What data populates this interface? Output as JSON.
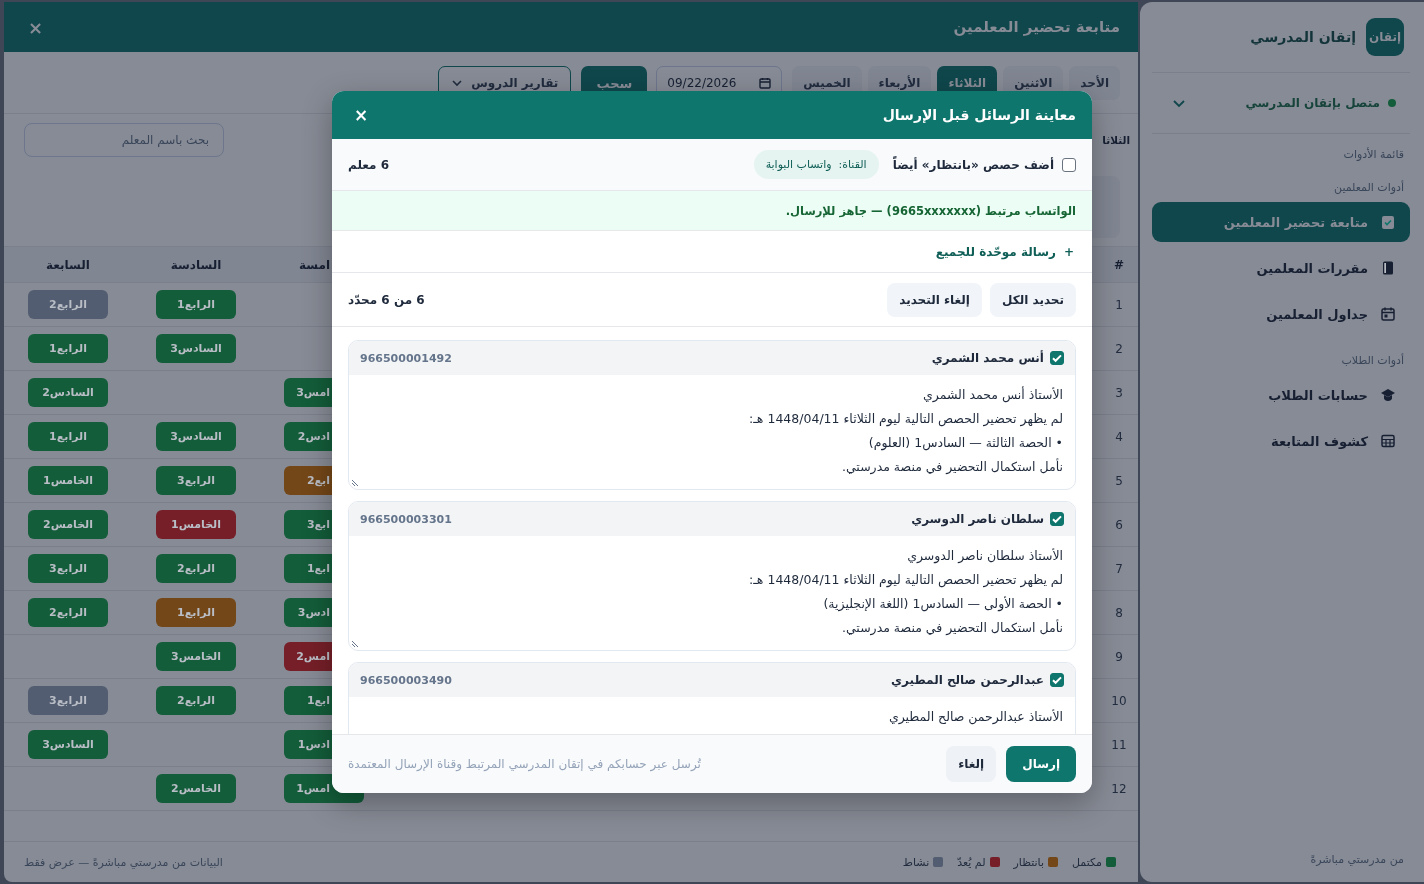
{
  "main_panel": {
    "title": "متابعة تحضير المعلمين",
    "close": "×"
  },
  "day_tabs": [
    {
      "label": "الأحد",
      "selected": false
    },
    {
      "label": "الاثنين",
      "selected": false
    },
    {
      "label": "الثلاثاء",
      "selected": true
    },
    {
      "label": "الأربعاء",
      "selected": false
    },
    {
      "label": "الخميس",
      "selected": false
    }
  ],
  "date_field": {
    "value": "09/22/2026"
  },
  "pull_button": "سحب",
  "reports_dropdown": {
    "label": "تقارير الدروس"
  },
  "day_heading": "الثلاثا",
  "search": {
    "placeholder": "بحث باسم المعلم"
  },
  "table": {
    "columns": [
      "#",
      "امسة",
      "السادسة",
      "السابعة"
    ],
    "rows": [
      {
        "cells": [
          "1",
          null,
          {
            "text": "الرابع1",
            "color": "#135d3a"
          },
          {
            "text": "الرابع2",
            "color": "#525d71"
          }
        ]
      },
      {
        "cells": [
          "2",
          null,
          {
            "text": "السادس3",
            "color": "#135d3a"
          },
          {
            "text": "الرابع1",
            "color": "#135d3a"
          }
        ]
      },
      {
        "cells": [
          "3",
          {
            "text": "امس3",
            "color": "#135d3a"
          },
          null,
          {
            "text": "السادس2",
            "color": "#135d3a"
          }
        ]
      },
      {
        "cells": [
          "4",
          {
            "text": "ادس2",
            "color": "#135d3a"
          },
          {
            "text": "السادس3",
            "color": "#135d3a"
          },
          {
            "text": "الرابع1",
            "color": "#135d3a"
          }
        ]
      },
      {
        "cells": [
          "5",
          {
            "text": "ابع2",
            "color": "#744718"
          },
          {
            "text": "الرابع3",
            "color": "#135d3a"
          },
          {
            "text": "الخامس1",
            "color": "#135d3a"
          }
        ]
      },
      {
        "cells": [
          "6",
          {
            "text": "ابع3",
            "color": "#135d3a"
          },
          {
            "text": "الخامس1",
            "color": "#761f28"
          },
          {
            "text": "الخامس2",
            "color": "#135d3a"
          }
        ]
      },
      {
        "cells": [
          "7",
          {
            "text": "ابع1",
            "color": "#135d3a"
          },
          {
            "text": "الرابع2",
            "color": "#135d3a"
          },
          {
            "text": "الرابع3",
            "color": "#135d3a"
          }
        ]
      },
      {
        "cells": [
          "8",
          {
            "text": "ادس3",
            "color": "#135d3a"
          },
          {
            "text": "الرابع1",
            "color": "#744718"
          },
          {
            "text": "الرابع2",
            "color": "#135d3a"
          }
        ]
      },
      {
        "cells": [
          "9",
          {
            "text": "امس2",
            "color": "#761f28"
          },
          {
            "text": "الخامس3",
            "color": "#135d3a"
          },
          null
        ]
      },
      {
        "cells": [
          "10",
          {
            "text": "ابع1",
            "color": "#135d3a"
          },
          {
            "text": "الرابع2",
            "color": "#135d3a"
          },
          {
            "text": "الرابع3",
            "color": "#525d71"
          }
        ]
      },
      {
        "cells": [
          "11",
          {
            "text": "ادس1",
            "color": "#135d3a"
          },
          null,
          {
            "text": "السادس3",
            "color": "#135d3a"
          }
        ]
      },
      {
        "cells": [
          "12",
          {
            "text": "امس1",
            "color": "#135d3a"
          },
          {
            "text": "الخامس2",
            "color": "#135d3a"
          },
          null
        ]
      }
    ]
  },
  "legend": [
    {
      "label": "مكتمل",
      "color": "#135d3a"
    },
    {
      "label": "بانتظار",
      "color": "#744718"
    },
    {
      "label": "لم يُعدّ",
      "color": "#761f28"
    },
    {
      "label": "نشاط",
      "color": "#525d71"
    }
  ],
  "footer_note": "البيانات من مدرستي مباشرةً — عرض فقط",
  "sidebar": {
    "logo_text": "إتقان",
    "brand": "إتقان المدرسي",
    "connection": {
      "label": "متصل بإتقان المدرسي",
      "connected": true
    },
    "menu_caption": "قائمة الأدوات",
    "sections": [
      {
        "title": "أدوات المعلمين",
        "items": [
          {
            "label": "متابعة تحضير المعلمين",
            "selected": true
          },
          {
            "label": "مقررات المعلمين",
            "selected": false
          },
          {
            "label": "جداول المعلمين",
            "selected": false
          }
        ]
      },
      {
        "title": "أدوات الطلاب",
        "items": [
          {
            "label": "حسابات الطلاب",
            "selected": false
          },
          {
            "label": "كشوف المتابعة",
            "selected": false
          }
        ]
      }
    ],
    "footer": "من مدرستي مباشرةً"
  },
  "modal": {
    "title": "معاينة الرسائل قبل الإرسال",
    "close": "×",
    "include_waiting": {
      "label": "أضف حصص «بانتظار» أيضاً",
      "checked": false
    },
    "channel_chip": "القناة:  واتساب البوابة",
    "teacher_count": "6 معلم",
    "notice": "الواتساب مرتبط (9665xxxxxxx) — جاهز للإرسال.",
    "unified_link": {
      "icon": "+",
      "label": "رسالة موحّدة للجميع"
    },
    "select_all": "تحديد الكل",
    "deselect_all": "إلغاء التحديد",
    "selected_count": "6 من 6 محدّد",
    "messages": [
      {
        "name": "أنس محمد الشمري",
        "phone": "966500001492",
        "checked": true,
        "text": "الأستاذ أنس محمد الشمري\nلم يظهر تحضير الحصص التالية ليوم الثلاثاء 1448/04/11 هـ:\n• الحصة الثالثة — السادس1 (العلوم)\nنأمل استكمال التحضير في منصة مدرستي."
      },
      {
        "name": "سلطان ناصر الدوسري",
        "phone": "966500003301",
        "checked": true,
        "text": "الأستاذ سلطان ناصر الدوسري\nلم يظهر تحضير الحصص التالية ليوم الثلاثاء 1448/04/11 هـ:\n• الحصة الأولى — السادس1 (اللغة الإنجليزية)\nنأمل استكمال التحضير في منصة مدرستي."
      },
      {
        "name": "عبدالرحمن صالح المطيري",
        "phone": "966500003490",
        "checked": true,
        "text": "الأستاذ عبدالرحمن صالح المطيري"
      }
    ],
    "send": "إرسال",
    "cancel": "إلغاء",
    "hint": "تُرسل عبر حسابكم في إتقان المدرسي المرتبط وقناة الإرسال المعتمدة"
  }
}
